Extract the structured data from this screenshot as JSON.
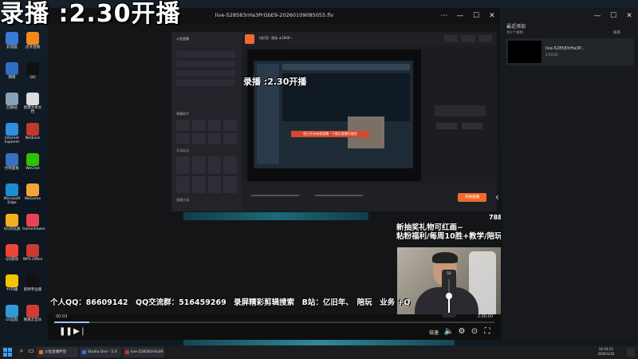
{
  "overlay": {
    "top_banner": "录播 :2.30开播"
  },
  "desktop": {
    "icons": [
      {
        "label": "此电脑",
        "color": "#3b7bd8"
      },
      {
        "label": "网络",
        "color": "#2f6cc4"
      },
      {
        "label": "回收站",
        "color": "#8aa0b8"
      },
      {
        "label": "Internet Explorer",
        "color": "#2c8fe0"
      },
      {
        "label": "控制面板",
        "color": "#3a6fc0"
      },
      {
        "label": "Microsoft Edge",
        "color": "#1f8bd6"
      },
      {
        "label": "QQ浏览器",
        "color": "#f2b01e"
      },
      {
        "label": "QQ游戏",
        "color": "#e9453a"
      },
      {
        "label": "YY开播",
        "color": "#f3c400"
      },
      {
        "label": "UU远程",
        "color": "#2f9ad8"
      },
      {
        "label": "虎牙直播",
        "color": "#f08a1a"
      },
      {
        "label": "QQ",
        "color": "#111"
      },
      {
        "label": "新建文本文档",
        "color": "#dcdcdc"
      },
      {
        "label": "NetEase",
        "color": "#c0392b"
      },
      {
        "label": "WeChat",
        "color": "#2dc100"
      },
      {
        "label": "WeGame",
        "color": "#f2a43a"
      },
      {
        "label": "GameViewer",
        "color": "#e6445a"
      },
      {
        "label": "WPS Office",
        "color": "#c93a2f"
      },
      {
        "label": "剪映专业版",
        "color": "#111"
      },
      {
        "label": "网易云音乐",
        "color": "#d43c33"
      }
    ]
  },
  "player": {
    "title": "live-528583rHa3PrGbE9-20260109085055.flv",
    "window_buttons": {
      "minimize": "—",
      "maximize": "☐",
      "close": "✕"
    },
    "current_time": "00:03",
    "total_time": "2:00:00",
    "progress": 0.08,
    "speed_label": "倍速",
    "volume": {
      "value": "50",
      "level": 0.5
    }
  },
  "stream_content": {
    "live_overlay": "录播 :2.30开播",
    "app_title": "【老司】 图标 ★2800~",
    "start_button": "开始直播",
    "red_notice": "您已开启有限直播 · 下载后直播可使用",
    "quick_labels": [
      "弹幕助手",
      "互动玩法",
      "直播工具"
    ],
    "ticker": "个人QQ：86609142　QQ交流群：516459269　录屏精彩剪辑搜索　B站：亿旧年、　陪玩　业务 +Q",
    "promo_top": "788",
    "promo_line1": "新抽奖礼物可红画~",
    "promo_line2": "粘粉福利/每周10胜+教学/陪玩"
  },
  "recent_panel": {
    "title": "最近添加",
    "subtitle": "共1个视频",
    "sort": "排序",
    "items": [
      {
        "name": "live-528583rHa3P...",
        "duration": "2:00:00"
      }
    ]
  },
  "taskbar": {
    "items": [
      {
        "label": "斗鱼直播伴侣",
        "color": "#f06a2d"
      },
      {
        "label": "Studio One - 5.0",
        "color": "#3a6fd8"
      },
      {
        "label": "live-528583rHa3P...",
        "color": "#c0392b"
      }
    ],
    "time": "14:10:23",
    "date": "2026/1/10"
  },
  "colors": {
    "accent": "#f06a2d",
    "seek": "#9fc2ff"
  }
}
